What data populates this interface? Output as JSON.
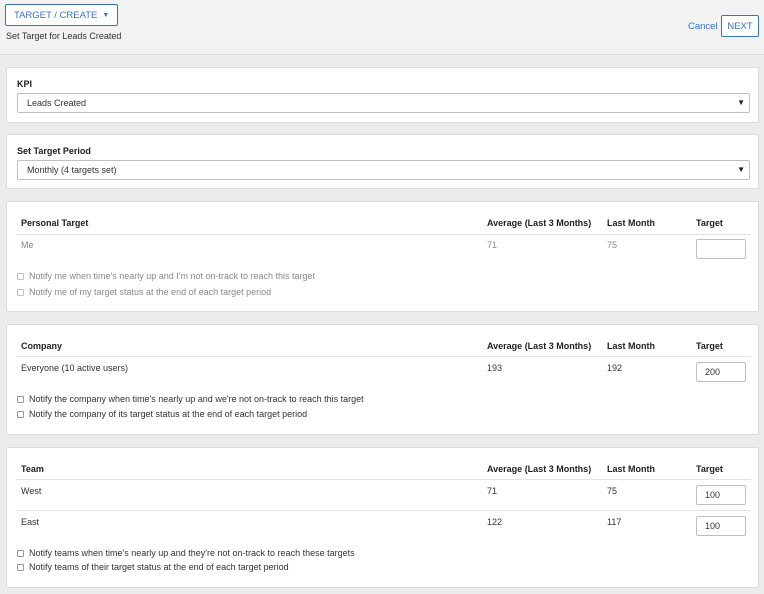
{
  "header": {
    "breadcrumb": "TARGET / CREATE",
    "subtitle": "Set Target for Leads Created",
    "cancel_label": "Cancel",
    "next_label": "NEXT"
  },
  "kpi": {
    "label": "KPI",
    "selected": "Leads Created"
  },
  "period": {
    "label": "Set Target Period",
    "selected": "Monthly (4 targets set)"
  },
  "columns": {
    "average": "Average (Last 3 Months)",
    "last_month": "Last Month",
    "target": "Target"
  },
  "personal": {
    "title": "Personal Target",
    "rows": [
      {
        "name": "Me",
        "average": "71",
        "last_month": "75",
        "target": ""
      }
    ],
    "notify": [
      "Notify me when time's nearly up and I'm not on-track to reach this target",
      "Notify me of my target status at the end of each target period"
    ]
  },
  "company": {
    "title": "Company",
    "rows": [
      {
        "name": "Everyone (10 active users)",
        "average": "193",
        "last_month": "192",
        "target": "200"
      }
    ],
    "notify": [
      "Notify the company when time's nearly up and we're not on-track to reach this target",
      "Notify the company of its target status at the end of each target period"
    ]
  },
  "team": {
    "title": "Team",
    "rows": [
      {
        "name": "West",
        "average": "71",
        "last_month": "75",
        "target": "100"
      },
      {
        "name": "East",
        "average": "122",
        "last_month": "117",
        "target": "100"
      }
    ],
    "notify": [
      "Notify teams when time's nearly up and they're not on-track to reach these targets",
      "Notify teams of their target status at the end of each target period"
    ]
  },
  "colors": {
    "accent": "#3b73b9",
    "muted_text": "#8a8a8a"
  }
}
